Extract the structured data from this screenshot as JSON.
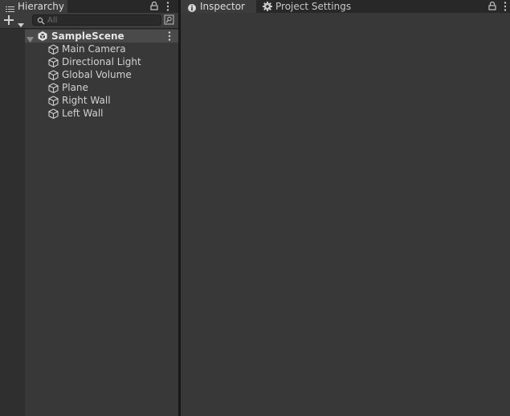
{
  "hierarchy": {
    "tab_label": "Hierarchy",
    "search_placeholder": "All",
    "scene": {
      "name": "SampleScene"
    },
    "items": [
      {
        "label": "Main Camera"
      },
      {
        "label": "Directional Light"
      },
      {
        "label": "Global Volume"
      },
      {
        "label": "Plane"
      },
      {
        "label": "Right Wall"
      },
      {
        "label": "Left Wall"
      }
    ]
  },
  "inspector": {
    "tabs": [
      {
        "label": "Inspector",
        "icon": "info-icon"
      },
      {
        "label": "Project Settings",
        "icon": "gear-icon"
      }
    ]
  },
  "icons": {
    "hierarchy_tab": "hierarchy-list-icon",
    "lock": "lock-icon",
    "more": "kebab-menu-icon",
    "add": "plus-icon",
    "search": "search-icon",
    "search_mode": "scene-search-mode-icon",
    "expand": "triangle-down-icon",
    "scene": "unity-scene-icon",
    "gameobject": "cube-icon"
  }
}
